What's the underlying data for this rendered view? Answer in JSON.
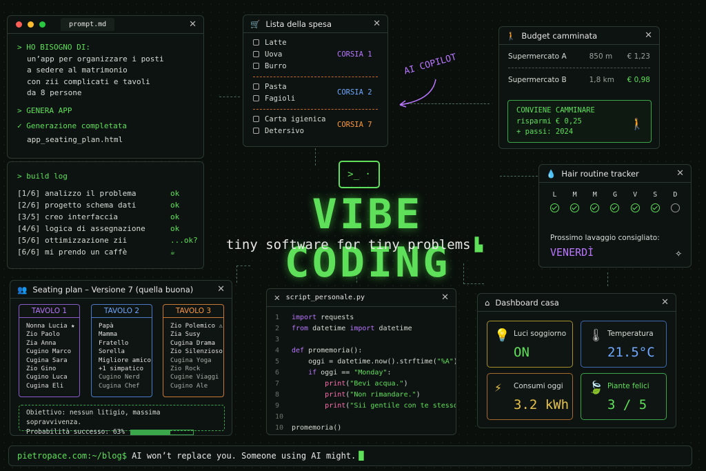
{
  "prompt": {
    "tab": "prompt.md",
    "need_label": "> HO BISOGNO DI:",
    "lines": [
      "un’app per organizzare i posti",
      "a sedere al matrimonio",
      "con zii complicati e tavoli",
      "da 8 persone"
    ],
    "generate": "> GENERA APP",
    "done": "✓ Generazione completata",
    "file": "app_seating_plan.html"
  },
  "build": {
    "title": "> build log",
    "steps": [
      {
        "n": "[1/6]",
        "t": "analizzo il problema",
        "s": "ok"
      },
      {
        "n": "[2/6]",
        "t": "progetto schema dati",
        "s": "ok"
      },
      {
        "n": "[3/5]",
        "t": "creo interfaccia",
        "s": "ok"
      },
      {
        "n": "[4/6]",
        "t": "logica di assegnazione",
        "s": "ok"
      },
      {
        "n": "[5/6]",
        "t": "ottimizzazione zii",
        "s": "...ok?"
      },
      {
        "n": "[6/6]",
        "t": "mi prendo un caffè",
        "s": "☕"
      }
    ]
  },
  "shopping": {
    "title": "Lista della spesa",
    "g1": [
      "Latte",
      "Uova",
      "Burro"
    ],
    "c1": "CORSIA 1",
    "g2": [
      "Pasta",
      "Fagioli"
    ],
    "c2": "CORSIA 2",
    "g3": [
      "Carta igienica",
      "Detersivo"
    ],
    "c3": "CORSIA 7"
  },
  "copilot": "AI COPILOT",
  "budget": {
    "title": "Budget camminata",
    "rows": [
      {
        "name": "Supermercato A",
        "dist": "850 m",
        "price": "€ 1,23"
      },
      {
        "name": "Supermercato B",
        "dist": "1,8 km",
        "price": "€ 0,98"
      }
    ],
    "box": [
      "CONVIENE CAMMINARE",
      "risparmi € 0,25",
      "+ passi: 2024"
    ]
  },
  "hair": {
    "title": "Hair routine tracker",
    "days": [
      "L",
      "M",
      "M",
      "G",
      "V",
      "S",
      "D"
    ],
    "next_label": "Prossimo lavaggio consigliato:",
    "next": "VENERDÌ"
  },
  "hero": {
    "title": "VIBE CODING",
    "subtitle": "tiny software for tiny problems"
  },
  "seating": {
    "title": "Seating plan – Versione 7 (quella buona)",
    "tables": [
      {
        "name": "TAVOLO 1",
        "guests": [
          "Nonna Lucia ★",
          "Zio Paolo",
          "Zia Anna",
          "Cugino Marco",
          "Cugina Sara",
          "Zio Gino",
          "Cugino Luca",
          "Cugina Eli"
        ]
      },
      {
        "name": "TAVOLO 2",
        "guests": [
          "Papà",
          "Mamma",
          "Fratello",
          "Sorella",
          "Migliore amico",
          "+1 simpatico",
          "Cugino Nerd",
          "Cugina Chef"
        ]
      },
      {
        "name": "TAVOLO 3",
        "guests": [
          "Zio Polemico ⚠",
          "Zia Susy",
          "Cugina Drama",
          "Zio Silenzioso",
          "Cugina Yoga",
          "Zio Rock",
          "Cugine Viaggi",
          "Cugino Ale"
        ]
      }
    ],
    "goal": "Obiettivo: nessun litigio, massima sopravvivenza.",
    "prob": "Probabilità successo: 63%",
    "prob_value": 63
  },
  "script": {
    "tab": "script_personale.py",
    "lines": [
      [
        "1",
        "import requests"
      ],
      [
        "2",
        "from datetime import datetime"
      ],
      [
        "3",
        ""
      ],
      [
        "4",
        "def promemoria():"
      ],
      [
        "5",
        "    oggi = datetime.now().strftime(\"%A\")"
      ],
      [
        "6",
        "    if oggi == \"Monday\":"
      ],
      [
        "7",
        "        print(\"Bevi acqua.\")"
      ],
      [
        "8",
        "        print(\"Non rimandare.\")"
      ],
      [
        "9",
        "        print(\"Sii gentile con te stesso.\")"
      ],
      [
        "10",
        ""
      ],
      [
        "10",
        "promemoria()"
      ]
    ]
  },
  "dashboard": {
    "title": "Dashboard casa",
    "tiles": [
      {
        "label": "Luci soggiorno",
        "value": "ON"
      },
      {
        "label": "Temperatura",
        "value": "21.5°C"
      },
      {
        "label": "Consumi oggi",
        "value": "3.2 kWh"
      },
      {
        "label": "Piante felici",
        "value": "3 / 5"
      }
    ]
  },
  "terminal": {
    "prompt": "pietropace.com:~/blog$",
    "text": " AI won’t replace you. Someone using AI might."
  },
  "colors": {
    "green": "#5fe05a",
    "purple": "#b977ff",
    "blue": "#6fa8ff",
    "orange": "#ff9a3c",
    "yellow": "#e6c24a"
  }
}
